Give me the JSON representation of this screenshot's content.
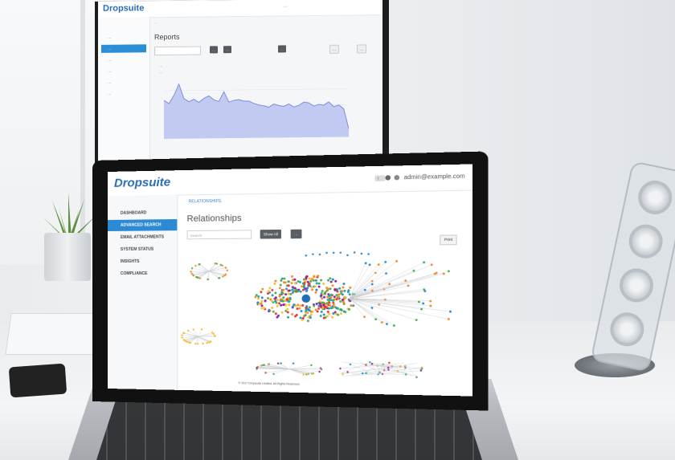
{
  "monitor": {
    "logo": "Dropsuite",
    "user_label": "…",
    "breadcrumb": "…",
    "title": "Reports",
    "search_placeholder": "…",
    "buttons": [
      "…",
      "…",
      "…"
    ],
    "right_buttons": [
      "…",
      "…"
    ],
    "sidebar_items": [
      {
        "label": "…",
        "active": false
      },
      {
        "label": "…",
        "active": true
      },
      {
        "label": "…",
        "active": false
      },
      {
        "label": "…",
        "active": false
      },
      {
        "label": "…",
        "active": false
      },
      {
        "label": "…",
        "active": false
      }
    ],
    "chart_title": "…",
    "chart_legend": "…",
    "chart_data": {
      "type": "area",
      "values": [
        48,
        44,
        54,
        68,
        50,
        46,
        49,
        45,
        50,
        53,
        48,
        46,
        58,
        45,
        47,
        48,
        46,
        46,
        43,
        41,
        40,
        38,
        42,
        40,
        39,
        42,
        38,
        40,
        44,
        43,
        39,
        41,
        40,
        44,
        38,
        40,
        35,
        10
      ],
      "color": "#7f8fe0"
    }
  },
  "laptop": {
    "logo": "Dropsuite",
    "logo_sub": "…",
    "user_email": "admin@example.com",
    "breadcrumb": "RELATIONSHIPS",
    "title": "Relationships",
    "search_placeholder": "Search",
    "buttons": [
      "Show All",
      "…"
    ],
    "print_label": "Print",
    "sidebar_items": [
      {
        "label": "DASHBOARD",
        "active": false
      },
      {
        "label": "ADVANCED SEARCH",
        "active": true
      },
      {
        "label": "EMAIL ATTACHMENTS",
        "active": false
      },
      {
        "label": "SYSTEM STATUS",
        "active": false
      },
      {
        "label": "INSIGHTS",
        "active": false
      },
      {
        "label": "COMPLIANCE",
        "active": false
      }
    ],
    "footer": "© 2017 Dropsuite Limited. All Rights Reserved.",
    "accent_color": "#2b8ad3"
  }
}
